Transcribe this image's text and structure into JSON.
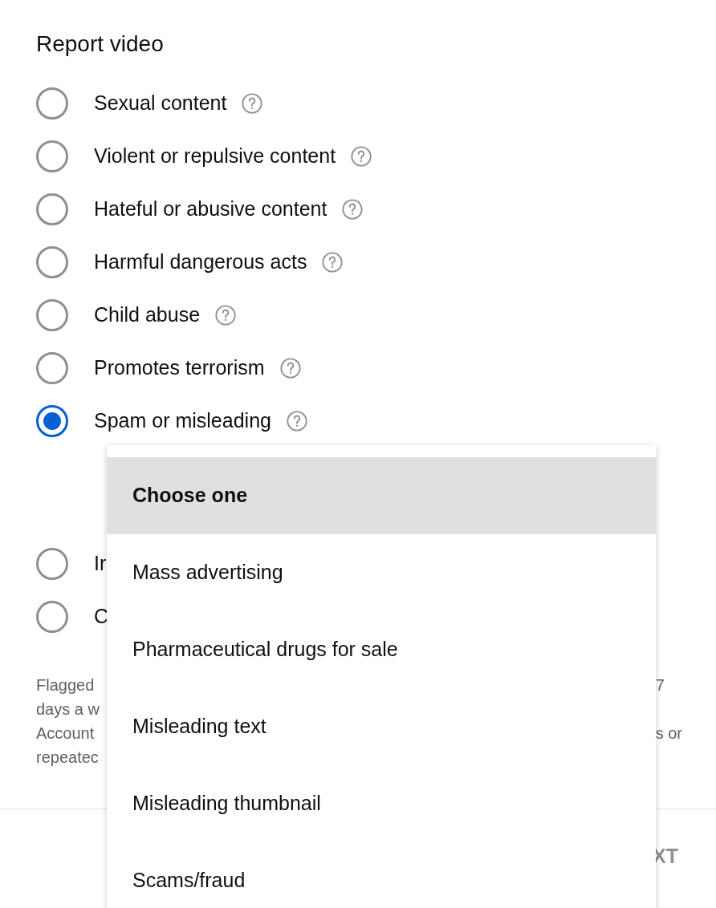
{
  "title": "Report video",
  "reasons": [
    {
      "label": "Sexual content",
      "selected": false,
      "help_icon": true
    },
    {
      "label": "Violent or repulsive content",
      "selected": false,
      "help_icon": true
    },
    {
      "label": "Hateful or abusive content",
      "selected": false,
      "help_icon": true
    },
    {
      "label": "Harmful dangerous acts",
      "selected": false,
      "help_icon": true
    },
    {
      "label": "Child abuse",
      "selected": false,
      "help_icon": true
    },
    {
      "label": "Promotes terrorism",
      "selected": false,
      "help_icon": true
    },
    {
      "label": "Spam or misleading",
      "selected": true,
      "help_icon": true
    },
    {
      "label": "Ir",
      "selected": false
    },
    {
      "label": "C",
      "selected": false
    }
  ],
  "description": {
    "left_lines": [
      "Flagged",
      "days a w",
      "Account",
      "repeatec"
    ],
    "right_lines": [
      "7",
      "s or"
    ]
  },
  "footer_button": "XT",
  "dropdown_menu": [
    {
      "label": "Choose one",
      "selected": true
    },
    {
      "label": "Mass advertising",
      "selected": false
    },
    {
      "label": "Pharmaceutical drugs for sale",
      "selected": false
    },
    {
      "label": "Misleading text",
      "selected": false
    },
    {
      "label": "Misleading thumbnail",
      "selected": false
    },
    {
      "label": "Scams/fraud",
      "selected": false
    }
  ]
}
